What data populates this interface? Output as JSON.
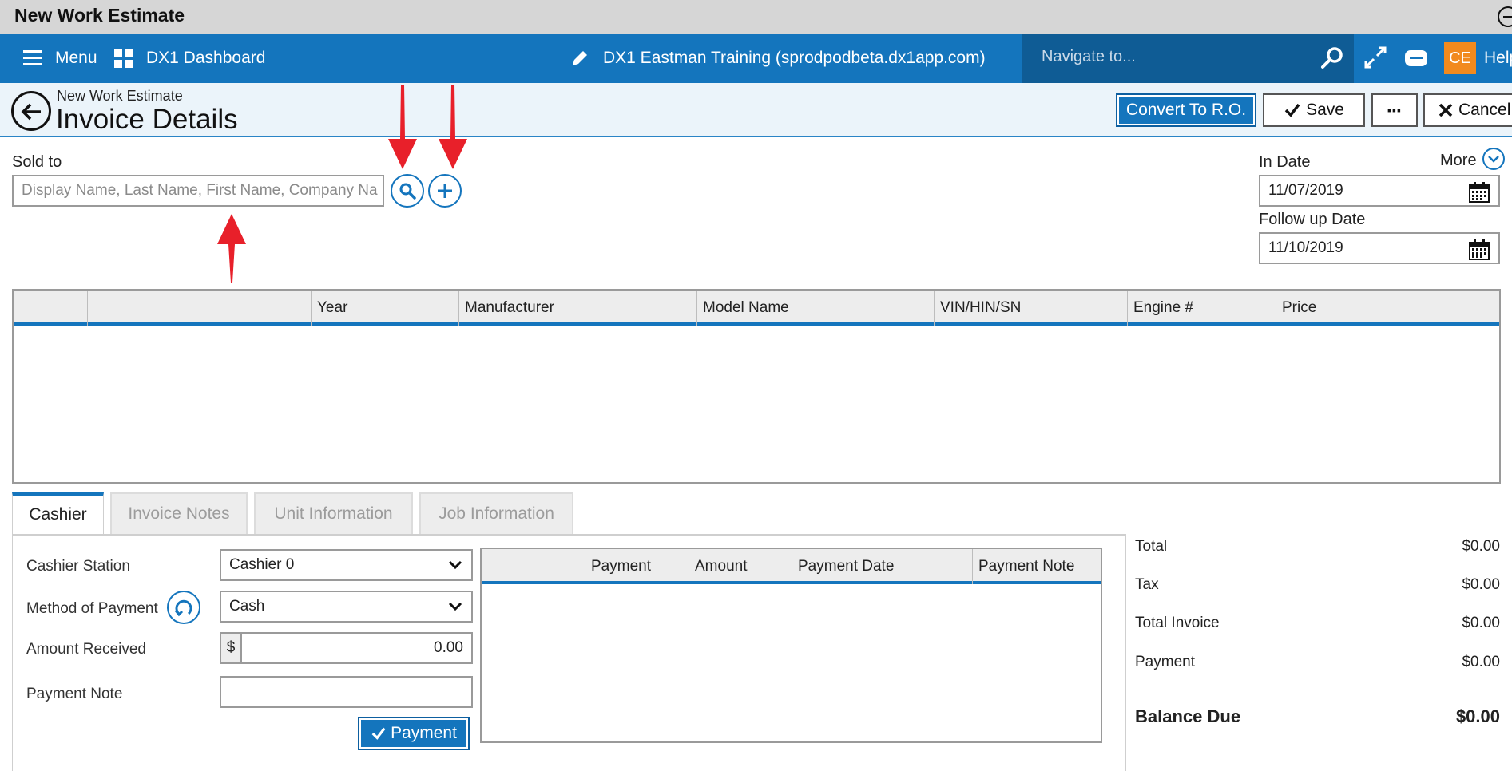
{
  "window": {
    "title": "New Work Estimate"
  },
  "appbar": {
    "menu_label": "Menu",
    "dashboard_label": "DX1 Dashboard",
    "center_title": "DX1 Eastman Training (sprodpodbeta.dx1app.com)",
    "navigate_placeholder": "Navigate to...",
    "avatar_initials": "CE",
    "help_label": "Help"
  },
  "header": {
    "breadcrumb": "New Work Estimate",
    "title": "Invoice Details",
    "convert_label": "Convert To R.O.",
    "save_label": "Save",
    "more_label": "▪▪▪",
    "cancel_label": "Cancel"
  },
  "sold_to": {
    "label": "Sold to",
    "placeholder": "Display Name, Last Name, First Name, Company Na"
  },
  "dates": {
    "more_label": "More",
    "in_date_label": "In Date",
    "in_date_value": "11/07/2019",
    "follow_up_label": "Follow up Date",
    "follow_up_value": "11/10/2019"
  },
  "unit_table": {
    "columns": [
      "",
      "",
      "Year",
      "Manufacturer",
      "Model Name",
      "VIN/HIN/SN",
      "Engine #",
      "Price"
    ]
  },
  "tabs": [
    {
      "label": "Cashier",
      "active": true
    },
    {
      "label": "Invoice Notes",
      "active": false
    },
    {
      "label": "Unit Information",
      "active": false
    },
    {
      "label": "Job Information",
      "active": false
    }
  ],
  "cashier": {
    "station_label": "Cashier Station",
    "station_value": "Cashier 0",
    "method_label": "Method of Payment",
    "method_value": "Cash",
    "amount_label": "Amount Received",
    "currency_symbol": "$",
    "amount_value": "0.00",
    "note_label": "Payment Note",
    "payment_button": "Payment"
  },
  "payment_table": {
    "columns": [
      "",
      "Payment",
      "Amount",
      "Payment Date",
      "Payment Note"
    ]
  },
  "summary": {
    "total_label": "Total",
    "total_value": "$0.00",
    "tax_label": "Tax",
    "tax_value": "$0.00",
    "total_invoice_label": "Total Invoice",
    "total_invoice_value": "$0.00",
    "payment_label": "Payment",
    "payment_value": "$0.00",
    "balance_label": "Balance Due",
    "balance_value": "$0.00"
  },
  "colors": {
    "accent": "#1475bd",
    "accent_dark": "#0f5c95",
    "avatar": "#f28a1e",
    "annotation_arrow": "#e8202a"
  }
}
